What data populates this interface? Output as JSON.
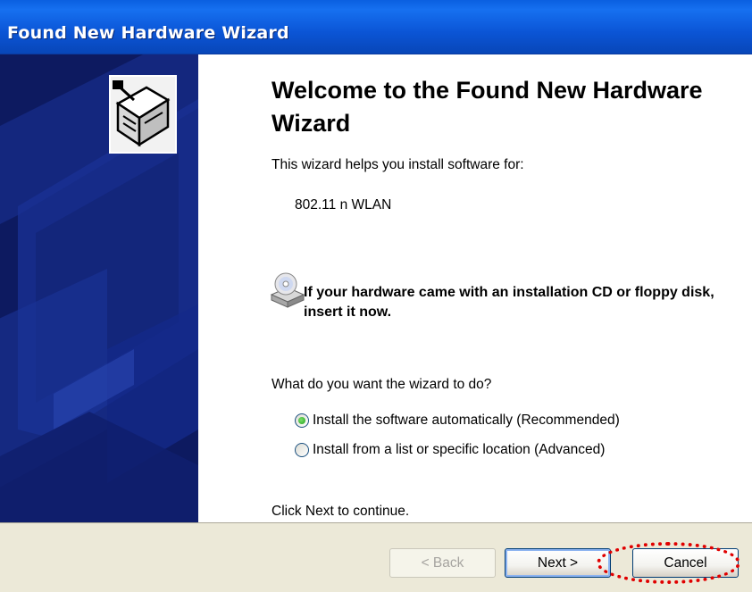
{
  "window": {
    "title": "Found New Hardware Wizard"
  },
  "main": {
    "heading": "Welcome to the Found New Hardware Wizard",
    "intro": "This wizard helps you install software for:",
    "device_name": "802.11 n WLAN",
    "cd_prompt": "If your hardware came with an installation CD or floppy disk, insert it now.",
    "question": "What do you want the wizard to do?",
    "options": [
      {
        "label": "Install the software automatically (Recommended)",
        "selected": true
      },
      {
        "label": "Install from a list or specific location (Advanced)",
        "selected": false
      }
    ],
    "continue_hint": "Click Next to continue."
  },
  "footer": {
    "back_label": "< Back",
    "next_label": "Next >",
    "cancel_label": "Cancel",
    "back_enabled": false
  },
  "icons": {
    "title": "hardware-device-icon",
    "cd": "cd-drive-icon",
    "radio_selected": "radio-selected-icon",
    "radio_unselected": "radio-unselected-icon"
  },
  "colors": {
    "titlebar": "#0b55d6",
    "side_panel": "#0d1a60",
    "footer": "#ece9d8",
    "highlight": "#e00000",
    "radio_selected": "#21a11f"
  }
}
